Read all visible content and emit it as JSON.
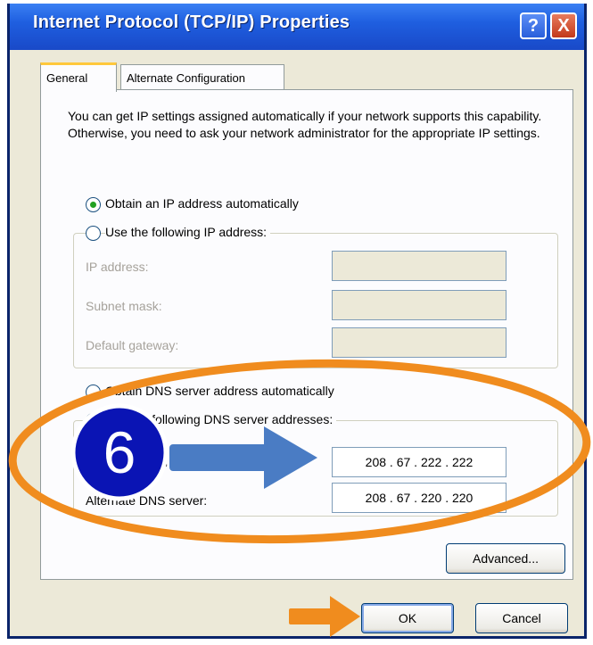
{
  "window": {
    "title": "Internet Protocol (TCP/IP) Properties",
    "help_label": "?",
    "close_label": "X"
  },
  "tabs": [
    {
      "label": "General",
      "active": true
    },
    {
      "label": "Alternate Configuration",
      "active": false
    }
  ],
  "description": "You can get IP settings assigned automatically if your network supports this capability. Otherwise, you need to ask your network administrator for the appropriate IP settings.",
  "ip_mode": {
    "auto_label": "Obtain an IP address automatically",
    "manual_label": "Use the following IP address:",
    "selected": "auto"
  },
  "ip_fields": {
    "ip_address_label": "IP address:",
    "subnet_mask_label": "Subnet mask:",
    "default_gateway_label": "Default gateway:",
    "ip_address_value": "",
    "subnet_mask_value": "",
    "default_gateway_value": ""
  },
  "dns_mode": {
    "auto_label": "Obtain DNS server address automatically",
    "manual_label": "Use the following DNS server addresses:",
    "selected": "manual"
  },
  "dns_fields": {
    "preferred_label": "Preferred DNS server:",
    "alternate_label": "Alternate DNS server:",
    "preferred_value": "208 . 67 . 222 . 222",
    "alternate_value": "208 . 67 . 220 . 220"
  },
  "buttons": {
    "advanced": "Advanced...",
    "ok": "OK",
    "cancel": "Cancel"
  },
  "annotation": {
    "step_number": "6",
    "highlight_color": "#f08c1e",
    "arrow_color": "#4a7cc4",
    "badge_color": "#0a14b4"
  }
}
